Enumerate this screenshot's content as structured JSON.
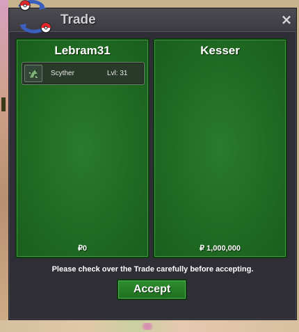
{
  "window": {
    "title": "Trade",
    "close_glyph": "×"
  },
  "players": [
    {
      "name": "Lebram31",
      "money": "₽0",
      "pokemon": [
        {
          "icon": "scyther-icon",
          "name": "Scyther",
          "level": "Lvl: 31"
        }
      ]
    },
    {
      "name": "Kesser",
      "money": "₽ 1,000,000",
      "pokemon": []
    }
  ],
  "notice": "Please check over the Trade carefully before accepting.",
  "accept_label": "Accept",
  "colors": {
    "panel_green": "#1f6a22",
    "window_bg": "#2f2e36",
    "accept_green": "#2f8e30"
  }
}
